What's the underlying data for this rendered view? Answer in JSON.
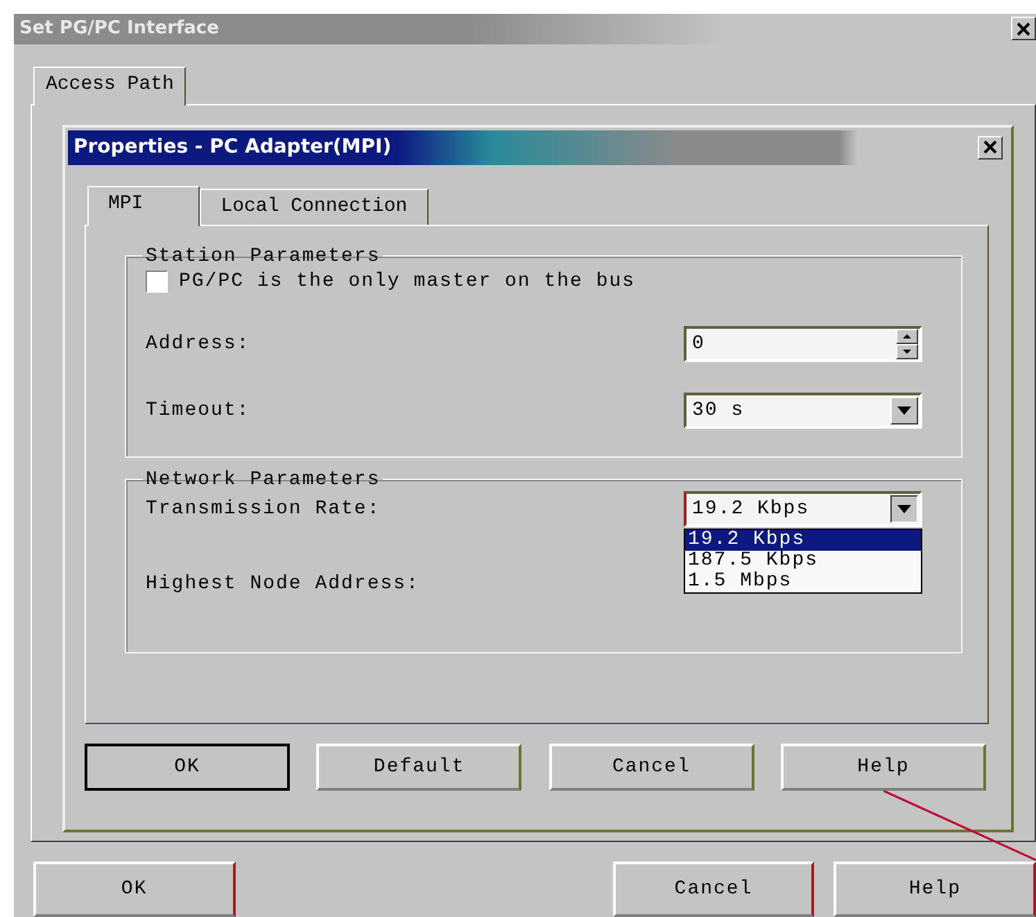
{
  "outer_window": {
    "title": "Set PG/PC Interface",
    "tabs": [
      {
        "label": "Access Path",
        "selected": true
      }
    ],
    "buttons": [
      {
        "label": "OK"
      },
      {
        "label": "Cancel"
      },
      {
        "label": "Help"
      }
    ]
  },
  "dialog": {
    "title": "Properties - PC Adapter(MPI)",
    "tabs": [
      {
        "label": "MPI",
        "selected": true
      },
      {
        "label": "Local Connection",
        "selected": false
      }
    ],
    "station_parameters": {
      "title": "Station Parameters",
      "checkbox": {
        "label": "PG/PC is the only master on the bus",
        "checked": false
      },
      "address": {
        "label": "Address:",
        "value": "0"
      },
      "timeout": {
        "label": "Timeout:",
        "value": "30 s"
      }
    },
    "network_parameters": {
      "title": "Network Parameters",
      "transmission_rate": {
        "label": "Transmission Rate:",
        "value": "19.2 Kbps",
        "expanded": true,
        "options": [
          {
            "label": "19.2 Kbps",
            "selected": true
          },
          {
            "label": "187.5 Kbps",
            "selected": false
          },
          {
            "label": "1.5 Mbps",
            "selected": false
          }
        ]
      },
      "highest_node_address": {
        "label": "Highest Node Address:"
      }
    },
    "buttons": [
      {
        "label": "OK",
        "default": true
      },
      {
        "label": "Default",
        "default": false
      },
      {
        "label": "Cancel",
        "default": false
      },
      {
        "label": "Help",
        "default": false
      }
    ]
  }
}
